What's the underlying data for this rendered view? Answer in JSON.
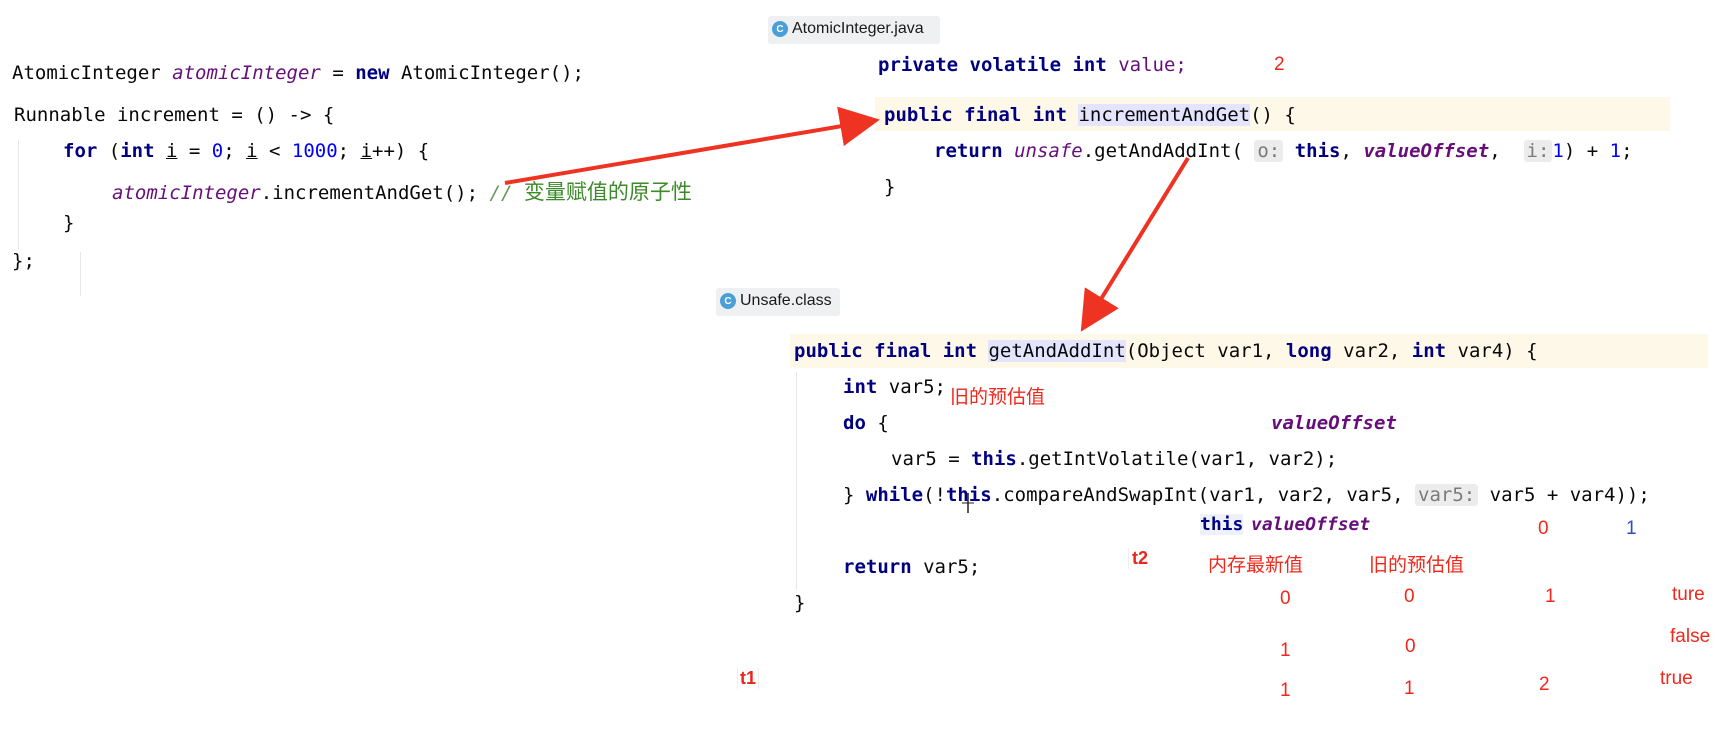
{
  "tabs": {
    "atomic_file": "AtomicInteger.java",
    "unsafe_file": "Unsafe.class",
    "icon_letter": "C"
  },
  "left_code": {
    "l1_type": "AtomicInteger ",
    "l1_var": "atomicInteger",
    "l1_eq": " = ",
    "l1_new": "new",
    "l1_rest": " AtomicInteger();",
    "l2": "Runnable increment = () -> {",
    "l3_for": "for",
    "l3_a": " (",
    "l3_int": "int",
    "l3_b": " ",
    "l3_i1": "i",
    "l3_c": " = ",
    "l3_zero": "0",
    "l3_d": "; ",
    "l3_i2": "i",
    "l3_e": " < ",
    "l3_thousand": "1000",
    "l3_f": "; ",
    "l3_i3": "i",
    "l3_g": "++) {",
    "l4_var": "atomicInteger",
    "l4_call": ".incrementAndGet(); ",
    "l4_comment": "// ",
    "l4_comment_cjk": "变量赋值的原子性",
    "l5": "}",
    "l6": "};"
  },
  "atomic_code": {
    "field_kw": "private volatile int",
    "field_name": " value;",
    "field_val": "2",
    "m_kw": "public final int",
    "m_name": "incrementAndGet",
    "m_rest": "() {",
    "r_kw": "return",
    "r_unsafe": "unsafe",
    "r_call": ".getAndAddInt(",
    "hint_o": "o:",
    "r_this": "this",
    "r_comma": ", ",
    "r_offset": "valueOffset",
    "r_comma2": ",  ",
    "hint_i": "i:",
    "r_one": "1",
    "r_plus": ") + ",
    "r_one2": "1",
    "r_end": ";",
    "close": "}"
  },
  "unsafe_code": {
    "sig_kw": "public final int",
    "sig_name": "getAndAddInt",
    "sig_p1": "(Object var1, ",
    "sig_long": "long",
    "sig_p2": " var2, ",
    "sig_int": "int",
    "sig_p3": " var4) {",
    "decl_int": "int",
    "decl_var": " var5;",
    "decl_note": "旧的预估值",
    "do_kw": "do",
    "do_brace": " {",
    "offset_note": "valueOffset",
    "assign_a": "var5 = ",
    "assign_this": "this",
    "assign_rest": ".getIntVolatile(var1, var2);",
    "while_a": "} ",
    "while_kw": "while",
    "while_b": "(!",
    "while_this": "this",
    "while_rest": ".compareAndSwapInt(var1, var2, var5, ",
    "hint_var5": "var5:",
    "while_end": "var5 + var4));",
    "ret_kw": "return",
    "ret_rest": " var5;",
    "close": "}"
  },
  "annotations": {
    "this_label": "this",
    "offset_label": "valueOffset",
    "zero_label": "0",
    "one_label": "1",
    "t2": "t2",
    "t1": "t1",
    "mem_latest": "内存最新值",
    "old_estimate": "旧的预估值",
    "rows": [
      {
        "mem": "0",
        "old": "0",
        "new": "1",
        "result": "ture"
      },
      {
        "mem": "1",
        "old": "0",
        "new": "",
        "result": "false"
      },
      {
        "mem": "1",
        "old": "1",
        "new": "2",
        "result": "true"
      }
    ]
  },
  "colors": {
    "keyword": "#000080",
    "field": "#660e7a",
    "number": "#0000ff",
    "comment": "#629755",
    "annotation_red": "#f0281c",
    "arrow_red": "#ee3322"
  }
}
